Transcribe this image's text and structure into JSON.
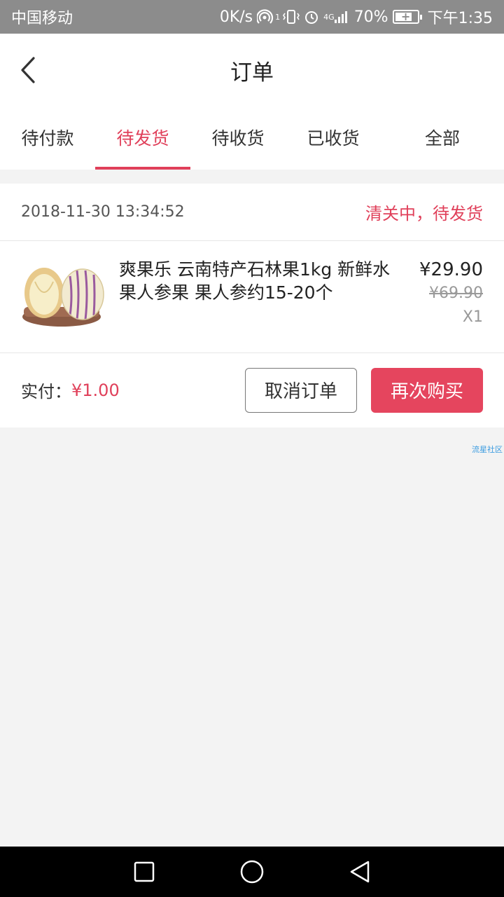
{
  "status_bar": {
    "carrier": "中国移动",
    "speed": "0K/s",
    "hotspot_badge": "1",
    "network_type": "4G",
    "battery": "70%",
    "time": "下午1:35"
  },
  "header": {
    "title": "订单"
  },
  "tabs": [
    {
      "label": "待付款",
      "active": false
    },
    {
      "label": "待发货",
      "active": true
    },
    {
      "label": "待收货",
      "active": false
    },
    {
      "label": "已收货",
      "active": false
    },
    {
      "label": "全部",
      "active": false
    }
  ],
  "order": {
    "time": "2018-11-30 13:34:52",
    "status": "清关中，待发货",
    "product": {
      "name": "爽果乐 云南特产石林果1kg 新鲜水果人参果 果人参约15-20个",
      "price": "¥29.90",
      "original_price": "¥69.90",
      "quantity": "X1"
    },
    "paid_label": "实付：",
    "paid_amount": "¥1.00",
    "cancel_label": "取消订单",
    "rebuy_label": "再次购买"
  },
  "watermark": "流星社区",
  "colors": {
    "accent": "#e0405a",
    "status_bar": "#8c8c8c"
  },
  "icons": {
    "back": "chevron-left-icon",
    "nav_recent": "square-icon",
    "nav_home": "circle-icon",
    "nav_back": "triangle-back-icon"
  }
}
